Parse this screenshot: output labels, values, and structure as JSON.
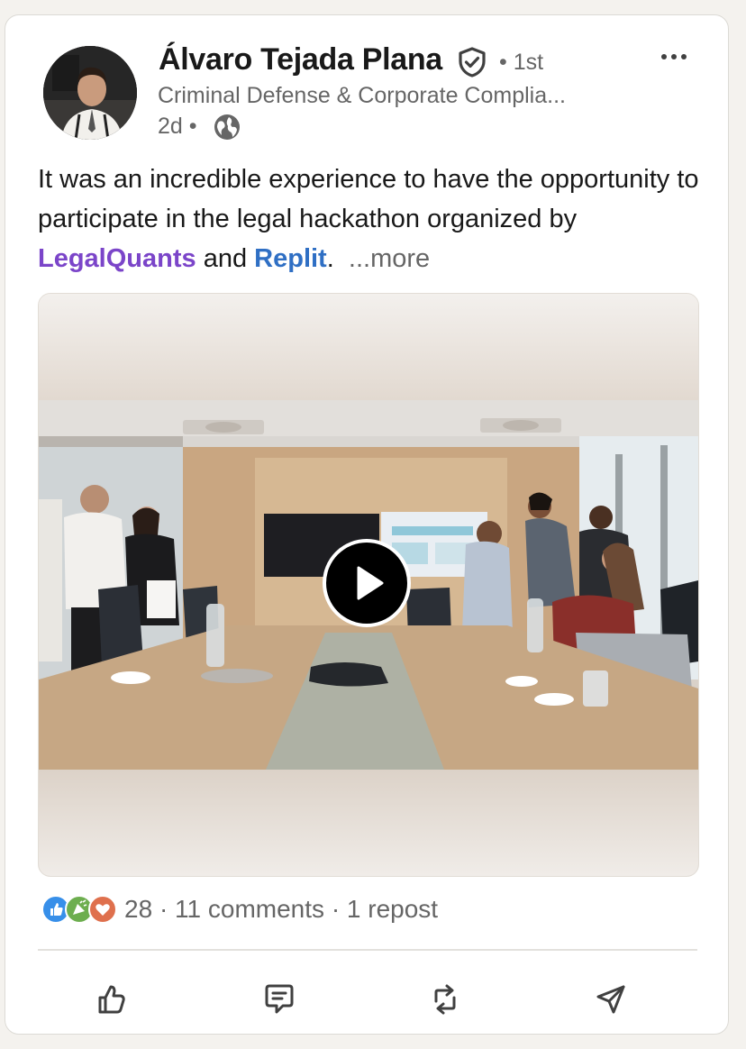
{
  "post": {
    "author_name": "Álvaro Tejada Plana",
    "connection_degree": "• 1st",
    "headline": "Criminal Defense & Corporate Complia...",
    "time_ago": "2d •",
    "text": {
      "part1": "It was an incredible experience to have the opportunity to participate in the legal hackathon organized by ",
      "mention1": "LegalQuants",
      "part2": " and ",
      "mention2": "Replit",
      "part3": ".",
      "see_more": "...more"
    },
    "reactions_count": "28",
    "comments": "· 11 comments",
    "reposts": "· 1 repost"
  },
  "icons": {
    "verified": "verified-shield-icon",
    "visibility": "globe-icon",
    "menu": "more-options-icon",
    "play": "play-icon",
    "actions": [
      "like-icon",
      "comment-icon",
      "repost-icon",
      "send-icon"
    ],
    "reactions": [
      "like-reaction-icon",
      "celebrate-reaction-icon",
      "love-reaction-icon"
    ]
  },
  "colors": {
    "mention_purple": "#7b45c9",
    "mention_blue": "#2f6fc4",
    "muted_text": "#666666",
    "primary_text": "#191919"
  }
}
